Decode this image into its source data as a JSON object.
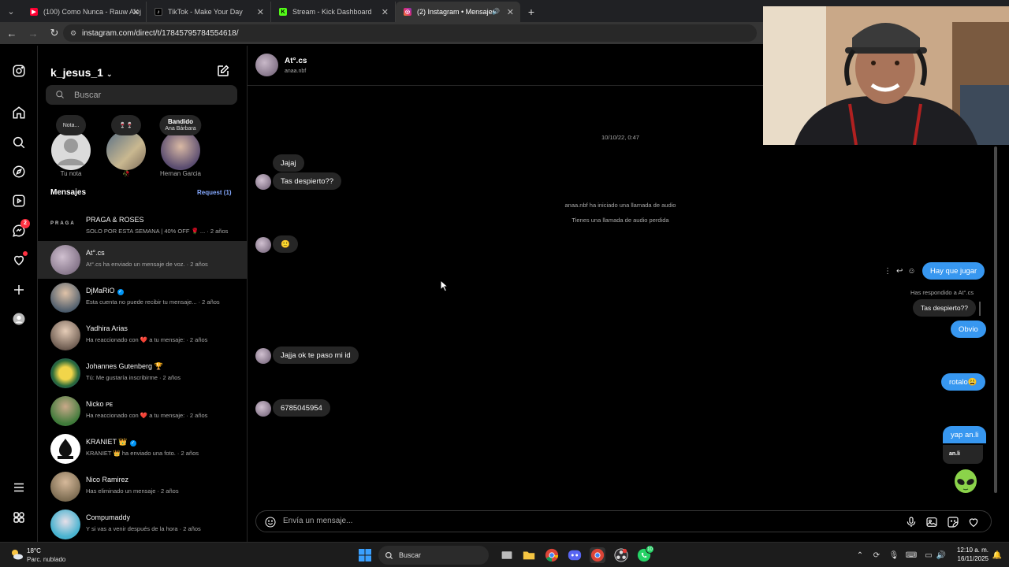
{
  "browser": {
    "tabs": [
      {
        "title": "(100) Como Nunca - Rauw Alej",
        "favicon": "youtube-icon",
        "color": "#ff0033"
      },
      {
        "title": "TikTok - Make Your Day",
        "favicon": "tiktok-icon",
        "color": "#ffffff"
      },
      {
        "title": "Stream - Kick Dashboard",
        "favicon": "kick-icon",
        "color": "#53fc18"
      },
      {
        "title": "(2) Instagram • Mensajes",
        "favicon": "instagram-icon",
        "color": "#e1306c"
      }
    ],
    "active_tab": 3,
    "url": "instagram.com/direct/t/17845795784554618/"
  },
  "nav_rail": {
    "items": [
      "instagram-logo-icon",
      "home-icon",
      "search-icon",
      "explore-icon",
      "reels-icon",
      "messenger-icon",
      "heart-icon",
      "create-icon",
      "profile-icon",
      "more-icon",
      "meta-icon"
    ],
    "messenger_badge": "2"
  },
  "inbox": {
    "username": "k_jesus_1",
    "search_placeholder": "Buscar",
    "notes": [
      {
        "bubble": "Nota...",
        "caption": "Tu nota"
      },
      {
        "bubble": "🍷🍷",
        "caption": "🥀"
      },
      {
        "bubble_title": "Bandido",
        "bubble_sub": "Ana Bárbara",
        "caption": "Hernan Garcia"
      }
    ],
    "section_title": "Mensajes",
    "requests_label": "Request (1)",
    "conversations": [
      {
        "name": "PRAGA & ROSES",
        "sub": "SOLO POR ESTA SEMANA | 40% OFF 🌹 ... · 2 años",
        "logo": "PRAGA"
      },
      {
        "name": "At°.cs",
        "sub": "At°.cs ha enviado un mensaje de voz. · 2 años",
        "selected": true
      },
      {
        "name": "DjMaRiO",
        "sub": "Esta cuenta no puede recibir tu mensaje... · 2 años",
        "verified": true
      },
      {
        "name": "Yadhira Arias",
        "sub": "Ha reaccionado con ❤️ a tu mensaje: · 2 años"
      },
      {
        "name": "Johannes Gutenberg 🏆",
        "sub": "Tú: Me gustaría inscribirme · 2 años"
      },
      {
        "name": "Nicko ᴘᴇ",
        "sub": "Ha reaccionado con ❤️ a tu mensaje: · 2 años"
      },
      {
        "name": "KRANIET 👑",
        "sub": "KRANIET 👑 ha enviado una foto. · 2 años",
        "verified": true
      },
      {
        "name": "Nico Ramirez",
        "sub": "Has eliminado un mensaje · 2 años"
      },
      {
        "name": "Compumaddy",
        "sub": "Y si vas a venir después de la hora · 2 años"
      }
    ]
  },
  "chat": {
    "contact_name": "At°.cs",
    "contact_handle": "anaa.nbf",
    "timestamp": "10/10/22, 0:47",
    "system_messages": [
      "anaa.nbf ha iniciado una llamada de audio",
      "Tienes una llamada de audio perdida"
    ],
    "messages": [
      {
        "dir": "in",
        "text": "Jajaj"
      },
      {
        "dir": "in",
        "text": "Tas despierto??"
      },
      {
        "dir": "in",
        "text": "🙂"
      },
      {
        "dir": "out",
        "text": "Hay que jugar"
      },
      {
        "dir": "out",
        "text": "Obvio",
        "reply_label": "Has respondido a At°.cs",
        "reply_quote": "Tas despierto??"
      },
      {
        "dir": "in",
        "text": "Jajja ok te paso mi id"
      },
      {
        "dir": "out",
        "text": "rotalo😩"
      },
      {
        "dir": "in",
        "text": "6785045954"
      },
      {
        "dir": "out",
        "text": "yap an.li",
        "link_preview": "an.li"
      },
      {
        "dir": "out",
        "text": "👽"
      }
    ],
    "composer_placeholder": "Envía un mensaje..."
  },
  "taskbar": {
    "weather_temp": "18°C",
    "weather_condition": "Parc. nublado",
    "search_label": "Buscar",
    "time": "12:10 a. m.",
    "date": "16/11/2025",
    "whatsapp_badge": "10"
  }
}
